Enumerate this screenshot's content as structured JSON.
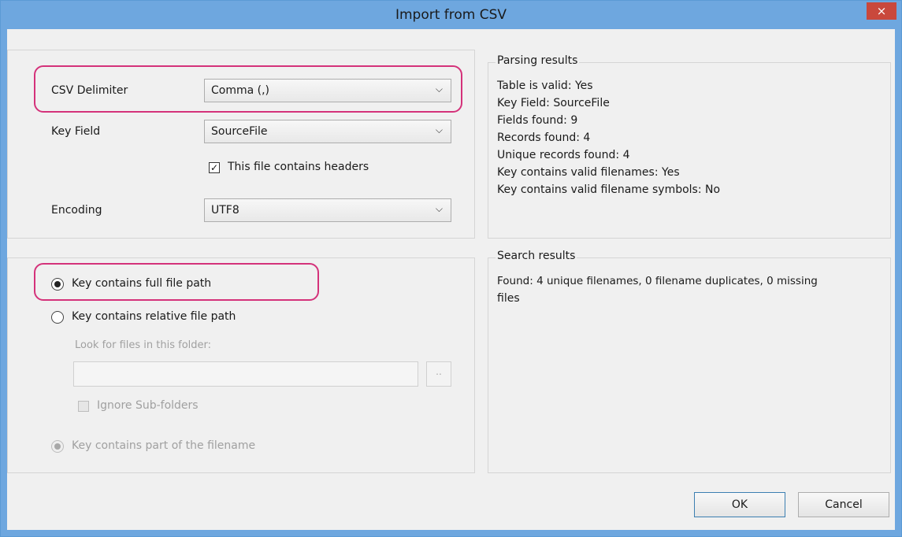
{
  "window": {
    "title": "Import from CSV",
    "close_label": "×"
  },
  "parsing_panel": {
    "csv_delimiter_label": "CSV Delimiter",
    "csv_delimiter_value": "Comma (,)",
    "key_field_label": "Key Field",
    "key_field_value": "SourceFile",
    "headers_checkbox_label": "This file contains headers",
    "headers_checked": true,
    "encoding_label": "Encoding",
    "encoding_value": "UTF8"
  },
  "key_panel": {
    "full_path_label": "Key contains full file path",
    "full_path_selected": true,
    "relative_path_label": "Key contains relative file path",
    "look_folder_label": "Look for files in this folder:",
    "folder_value": "",
    "browse_label": "..",
    "ignore_subfolders_label": "Ignore Sub-folders",
    "part_filename_label": "Key contains part of the filename"
  },
  "parsing_results": {
    "title": "Parsing results",
    "lines": [
      "Table is valid: Yes",
      "Key Field: SourceFile",
      "Fields found: 9",
      "Records found: 4",
      "Unique records found: 4",
      "Key contains valid filenames: Yes",
      "Key contains valid filename symbols: No"
    ]
  },
  "search_results": {
    "title": "Search results",
    "line1": "Found: 4 unique filenames, 0 filename duplicates, 0 missing",
    "line2": "files"
  },
  "buttons": {
    "ok": "OK",
    "cancel": "Cancel"
  },
  "colors": {
    "titlebar": "#6ea7df",
    "highlight": "#d4327a",
    "close": "#c9483c"
  }
}
